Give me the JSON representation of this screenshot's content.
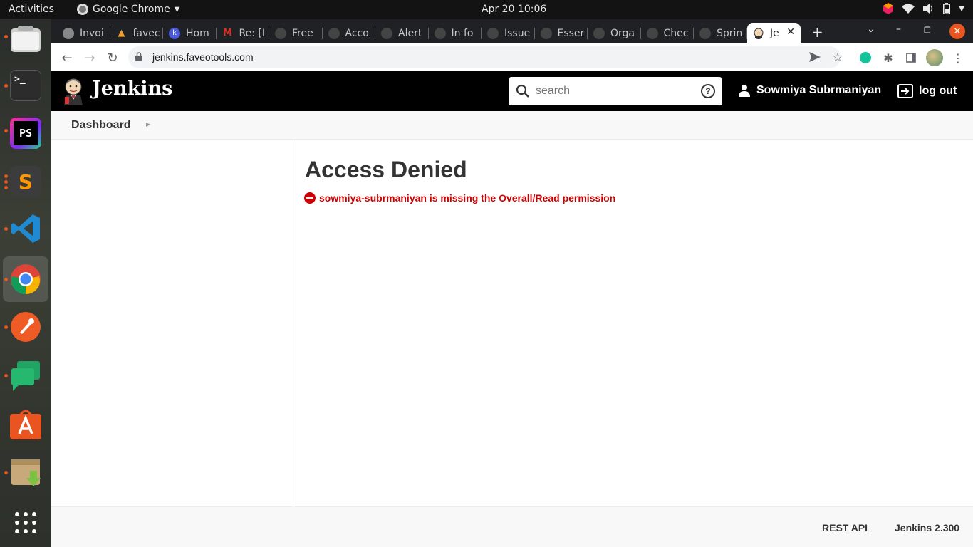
{
  "system": {
    "activities": "Activities",
    "app_name": "Google Chrome",
    "clock": "Apr 20  10:06"
  },
  "dock": {
    "items": [
      {
        "name": "Files",
        "icon": "folder-icon",
        "color": "#cfcfcf"
      },
      {
        "name": "Terminal",
        "icon": "terminal-icon",
        "color": "#2c2c2c"
      },
      {
        "name": "PhpStorm",
        "icon": "phpstorm-icon",
        "color": "#9b2bd9"
      },
      {
        "name": "Sublime Text",
        "icon": "sublime-icon",
        "color": "#3c3c3c"
      },
      {
        "name": "Visual Studio Code",
        "icon": "vscode-icon",
        "color": "#1f8ad2"
      },
      {
        "name": "Google Chrome",
        "icon": "chrome-icon",
        "color": "#4285f4"
      },
      {
        "name": "Postman",
        "icon": "postman-icon",
        "color": "#ef5b25"
      },
      {
        "name": "Google Chat",
        "icon": "chat-icon",
        "color": "#1fa463"
      },
      {
        "name": "Ubuntu Software",
        "icon": "software-icon",
        "color": "#e95420"
      },
      {
        "name": "Archive Manager",
        "icon": "archive-icon",
        "color": "#c8a97a"
      },
      {
        "name": "Show Applications",
        "icon": "apps-grid-icon",
        "color": "#ffffff"
      }
    ]
  },
  "browser": {
    "tabs": [
      {
        "title": "Invoi",
        "icon": "globe-icon",
        "color": "#888888"
      },
      {
        "title": "favec",
        "icon": "warning-icon",
        "color": "#f0a030"
      },
      {
        "title": "Hom",
        "icon": "k-icon",
        "color": "#4b5bdc"
      },
      {
        "title": "Re: [I",
        "icon": "gmail-icon",
        "color": "#d93025"
      },
      {
        "title": "Free",
        "icon": "github-icon",
        "color": "#444444"
      },
      {
        "title": "Acco",
        "icon": "github-icon",
        "color": "#444444"
      },
      {
        "title": "Alert",
        "icon": "github-icon",
        "color": "#444444"
      },
      {
        "title": "In fo",
        "icon": "github-icon",
        "color": "#444444"
      },
      {
        "title": "Issue",
        "icon": "github-icon",
        "color": "#444444"
      },
      {
        "title": "Esser",
        "icon": "github-icon",
        "color": "#444444"
      },
      {
        "title": "Orga",
        "icon": "github-icon",
        "color": "#444444"
      },
      {
        "title": "Chec",
        "icon": "github-icon",
        "color": "#444444"
      },
      {
        "title": "Sprin",
        "icon": "github-icon",
        "color": "#444444"
      }
    ],
    "active_tab": {
      "title": "Je",
      "icon": "jenkins-icon"
    },
    "url": "jenkins.faveotools.com"
  },
  "jenkins": {
    "title": "Jenkins",
    "search_placeholder": "search",
    "user": "Sowmiya Subrmaniyan",
    "logout": "log out",
    "breadcrumb": "Dashboard",
    "heading": "Access Denied",
    "error": "sowmiya-subrmaniyan is missing the Overall/Read permission",
    "footer": {
      "rest_api": "REST API",
      "version": "Jenkins 2.300"
    }
  }
}
